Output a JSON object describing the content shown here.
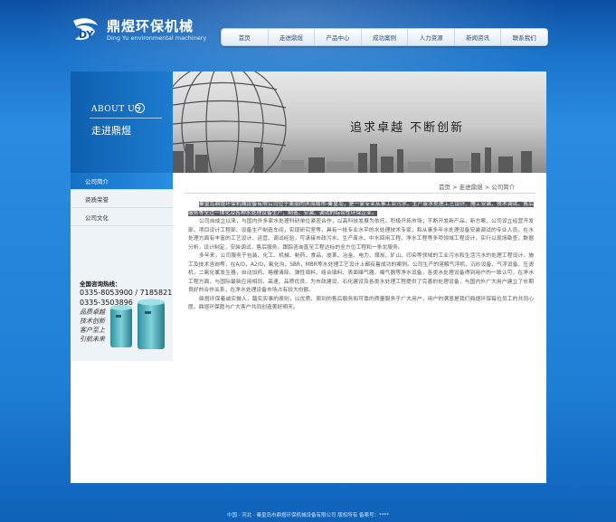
{
  "brand": {
    "name": "鼎煜环保机械",
    "subtitle": "Ding Yu environmental machinery"
  },
  "nav": [
    {
      "label": "首页"
    },
    {
      "label": "走进鼎煜"
    },
    {
      "label": "产品中心"
    },
    {
      "label": "成功案例"
    },
    {
      "label": "人力资源"
    },
    {
      "label": "新闻资讯"
    },
    {
      "label": "联系我们"
    }
  ],
  "section": {
    "title_en": "ABOUT US",
    "title_cn": "走进鼎煜"
  },
  "banner": {
    "slogan": "追求卓越  不断创新"
  },
  "sidebar": {
    "items": [
      {
        "label": "公司简介",
        "active": true
      },
      {
        "label": "资质荣誉",
        "active": false
      },
      {
        "label": "公司文化",
        "active": false
      }
    ]
  },
  "contact": {
    "title": "全国咨询热线：",
    "phone1": "0335-8053900 / 7185821",
    "phone2": "0335-3503896",
    "slogans": [
      "品质卓越",
      "技术创新",
      "客户至上",
      "引航未来"
    ]
  },
  "breadcrumb": {
    "home": "首页",
    "sep1": ">",
    "parent": "走进鼎煜",
    "sep2": ">",
    "current": "公司简介"
  },
  "article": {
    "p1_highlight": "秦皇岛鼎煜环保机械设备有限公司位于美丽的滨海城市-秦皇岛，是一家专业从事工业污水、生产废水处理工艺设计、施工安装、技术调试、售后服务等全过一体化及各种水处理设备生产、制造、安装、调试的综合性环保企业。",
    "p2": "公司自成立以来，与国内外多家水处理科研单位紧密合作，以高科技发展为依托，积极开拓市场；不断开发新产品，新方案，公司设立经营开发部、项目设计工程部、设备生产制造车间，实现研究室等，具有一批专业水平的水处理技术专家，和从事多年水处理设备安装调试的专业人员，在水处理方面有丰富的工艺设计、运营、调试经验，可承接市政污水、生产废水、中水回用工程、净水工程等多项领域工程设计，实行以现场勘查，数据分析，设计制定，安装调试，售后服务，跟踪咨询直至工程达标的全方位工程和一条龙服务。",
    "p3": "多年来，公司服务于包装、化工、机械、制药、食品、皮革、冶金、电力、煤炭、矿山、印染等领域的工业污水和生活污水的处理工程设计，施工及技术咨询等，在A/O，A2/O，氧化沟，SBR，MBR等水处理工艺设计上都有着成功的案例。公司生产的溶解气浮机、沉砂设备、气浮设备，压滤机，二氧化氯发生器，自动加药、格栅清除、弹性填料、组合填料、表面曝气器、曝气器等净水设备，各类水处理设备得到用户的一致认可，在净水工程方面，与国际最新应用相同，高速、品质优良，为市政建设、石化建设及各类水处理工程提供了完善的处理设备，与国内外广大用户建立了长期良好的合作关系，在净水处理设备市场占有较大份额。",
    "p4": "鼎煜环保着诚实做人，踏实实事的原则，以优质、周到的售后服务和可靠的质量服务于广大用户，用户的满意是我们鼎煜环保每位员工的共同心愿。鼎煜环保愿与广大客户共同创造美好明天。"
  },
  "footer": {
    "text": "中国 · 河北 · 秦皇岛市鼎煜环保机械设备有限公司  版权所有    备案号：****"
  },
  "colors": {
    "background": "#1a73c9",
    "accent": "#1471c6",
    "panel": "#ffffff"
  }
}
